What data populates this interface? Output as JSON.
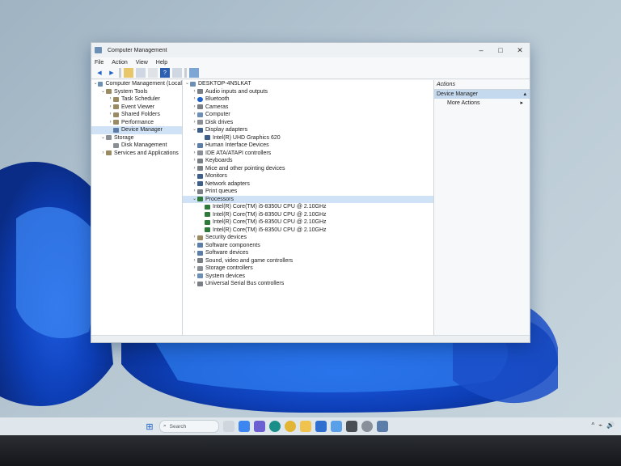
{
  "window": {
    "title": "Computer Management",
    "controls": {
      "minimize": "–",
      "maximize": "□",
      "close": "✕"
    }
  },
  "menu": [
    "File",
    "Action",
    "View",
    "Help"
  ],
  "toolbar_icons": [
    "back-arrow",
    "forward-arrow",
    "up-folder",
    "show-hide-tree",
    "properties",
    "help",
    "scan-hardware",
    "monitor"
  ],
  "left_tree": [
    {
      "label": "Computer Management (Local",
      "indent": 0,
      "twisty": "⌄",
      "icon": "comp"
    },
    {
      "label": "System Tools",
      "indent": 1,
      "twisty": "⌄",
      "icon": "tool"
    },
    {
      "label": "Task Scheduler",
      "indent": 2,
      "twisty": "›",
      "icon": "tool"
    },
    {
      "label": "Event Viewer",
      "indent": 2,
      "twisty": "›",
      "icon": "tool"
    },
    {
      "label": "Shared Folders",
      "indent": 2,
      "twisty": "›",
      "icon": "tool"
    },
    {
      "label": "Performance",
      "indent": 2,
      "twisty": "›",
      "icon": "tool"
    },
    {
      "label": "Device Manager",
      "indent": 2,
      "twisty": "",
      "icon": "dev",
      "selected": true
    },
    {
      "label": "Storage",
      "indent": 1,
      "twisty": "⌄",
      "icon": "store"
    },
    {
      "label": "Disk Management",
      "indent": 2,
      "twisty": "",
      "icon": "store"
    },
    {
      "label": "Services and Applications",
      "indent": 1,
      "twisty": "›",
      "icon": "tool"
    }
  ],
  "device_tree": [
    {
      "label": "DESKTOP-4N5LKAT",
      "indent": 0,
      "twisty": "⌄",
      "icon": "comp"
    },
    {
      "label": "Audio inputs and outputs",
      "indent": 1,
      "twisty": "›",
      "icon": "audio"
    },
    {
      "label": "Bluetooth",
      "indent": 1,
      "twisty": "›",
      "icon": "bt"
    },
    {
      "label": "Cameras",
      "indent": 1,
      "twisty": "›",
      "icon": "audio"
    },
    {
      "label": "Computer",
      "indent": 1,
      "twisty": "›",
      "icon": "comp"
    },
    {
      "label": "Disk drives",
      "indent": 1,
      "twisty": "›",
      "icon": "store"
    },
    {
      "label": "Display adapters",
      "indent": 1,
      "twisty": "⌄",
      "icon": "gpu"
    },
    {
      "label": "Intel(R) UHD Graphics 620",
      "indent": 2,
      "twisty": "",
      "icon": "gpu"
    },
    {
      "label": "Human Interface Devices",
      "indent": 1,
      "twisty": "›",
      "icon": "dev"
    },
    {
      "label": "IDE ATA/ATAPI controllers",
      "indent": 1,
      "twisty": "›",
      "icon": "store"
    },
    {
      "label": "Keyboards",
      "indent": 1,
      "twisty": "›",
      "icon": "audio"
    },
    {
      "label": "Mice and other pointing devices",
      "indent": 1,
      "twisty": "›",
      "icon": "audio"
    },
    {
      "label": "Monitors",
      "indent": 1,
      "twisty": "›",
      "icon": "gpu"
    },
    {
      "label": "Network adapters",
      "indent": 1,
      "twisty": "›",
      "icon": "gpu"
    },
    {
      "label": "Print queues",
      "indent": 1,
      "twisty": "›",
      "icon": "audio"
    },
    {
      "label": "Processors",
      "indent": 1,
      "twisty": "⌄",
      "icon": "cpu",
      "selected": true
    },
    {
      "label": "Intel(R) Core(TM) i5-8350U CPU @ 2.10GHz",
      "indent": 2,
      "twisty": "",
      "icon": "cpu"
    },
    {
      "label": "Intel(R) Core(TM) i5-8350U CPU @ 2.10GHz",
      "indent": 2,
      "twisty": "",
      "icon": "cpu"
    },
    {
      "label": "Intel(R) Core(TM) i5-8350U CPU @ 2.10GHz",
      "indent": 2,
      "twisty": "",
      "icon": "cpu"
    },
    {
      "label": "Intel(R) Core(TM) i5-8350U CPU @ 2.10GHz",
      "indent": 2,
      "twisty": "",
      "icon": "cpu"
    },
    {
      "label": "Security devices",
      "indent": 1,
      "twisty": "›",
      "icon": "tool"
    },
    {
      "label": "Software components",
      "indent": 1,
      "twisty": "›",
      "icon": "dev"
    },
    {
      "label": "Software devices",
      "indent": 1,
      "twisty": "›",
      "icon": "dev"
    },
    {
      "label": "Sound, video and game controllers",
      "indent": 1,
      "twisty": "›",
      "icon": "audio"
    },
    {
      "label": "Storage controllers",
      "indent": 1,
      "twisty": "›",
      "icon": "store"
    },
    {
      "label": "System devices",
      "indent": 1,
      "twisty": "›",
      "icon": "comp"
    },
    {
      "label": "Universal Serial Bus controllers",
      "indent": 1,
      "twisty": "›",
      "icon": "audio"
    }
  ],
  "actions": {
    "header": "Actions",
    "selected": "Device Manager",
    "selected_arrow": "▴",
    "more": "More Actions",
    "more_arrow": "▸"
  },
  "taskbar": {
    "search_placeholder": "Search",
    "icons": [
      "windows-start",
      "task-view",
      "widgets",
      "teams-chat",
      "edge",
      "chrome",
      "file-explorer",
      "mail",
      "photos",
      "camera",
      "settings",
      "device-manager"
    ],
    "tray": [
      "^",
      "⌁",
      "🔊"
    ]
  },
  "colors": {
    "accent": "#1f62c9",
    "selection": "#cfe2f6"
  }
}
